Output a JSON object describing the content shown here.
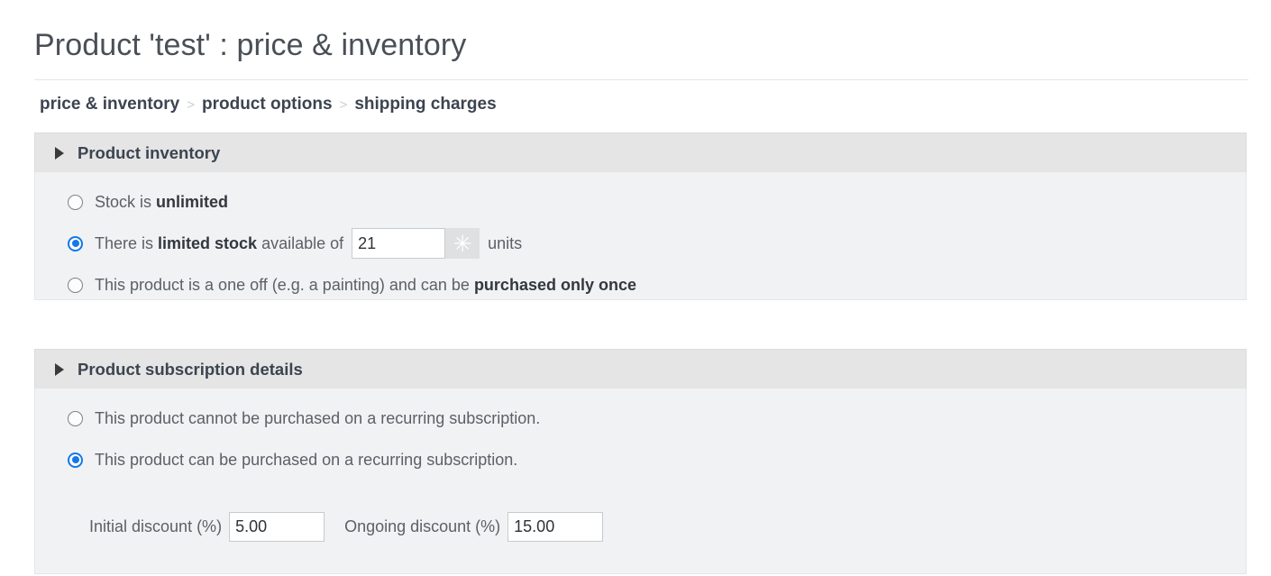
{
  "header": {
    "title": "Product 'test' : price & inventory"
  },
  "breadcrumb": {
    "separator": ">",
    "items": [
      {
        "label": "price & inventory"
      },
      {
        "label": "product options"
      },
      {
        "label": "shipping charges"
      }
    ]
  },
  "sections": [
    {
      "id": "inventory",
      "title": "Product inventory",
      "disclosure_icon": "triangle-right-icon",
      "collapsed": true,
      "options": [
        {
          "id": "stock-unlimited",
          "checked": false,
          "text_before": "Stock is",
          "text_bold": "unlimited",
          "text_after": ""
        },
        {
          "id": "stock-limited",
          "checked": true,
          "text_before": "There is",
          "text_bold": "limited stock",
          "text_after": "available of",
          "field": {
            "name": "stock-quantity-input",
            "value": "21",
            "placeholder": "",
            "spinner_icon": "asterisk-icon",
            "spinner_glyph": "✳",
            "suffix": "units"
          }
        },
        {
          "id": "stock-one-off",
          "checked": false,
          "text_before": "This product is a one off (e.g. a painting) and can be",
          "text_bold": "purchased only once",
          "text_after": ""
        }
      ]
    },
    {
      "id": "subscription",
      "title": "Product subscription details",
      "disclosure_icon": "triangle-right-icon",
      "collapsed": true,
      "options": [
        {
          "id": "subscription-no",
          "checked": false,
          "text_before": "This product cannot be purchased on a recurring subscription.",
          "text_bold": "",
          "text_after": ""
        },
        {
          "id": "subscription-yes",
          "checked": true,
          "text_before": "This product can be purchased on a recurring subscription.",
          "text_bold": "",
          "text_after": ""
        }
      ],
      "discounts": [
        {
          "label": "Initial discount (%)",
          "name": "initial-discount-input",
          "value": "5.00",
          "placeholder": ""
        },
        {
          "label": "Ongoing discount (%)",
          "name": "ongoing-discount-input",
          "value": "15.00",
          "placeholder": ""
        }
      ]
    }
  ],
  "colors": {
    "accent": "#1677e8",
    "panel_header_bg": "#e5e5e5",
    "panel_body_bg": "#f1f2f3",
    "title_text": "#4a4f57",
    "body_text": "#5c6066",
    "bold_text": "#33383f",
    "separator": "#c9ced4"
  }
}
